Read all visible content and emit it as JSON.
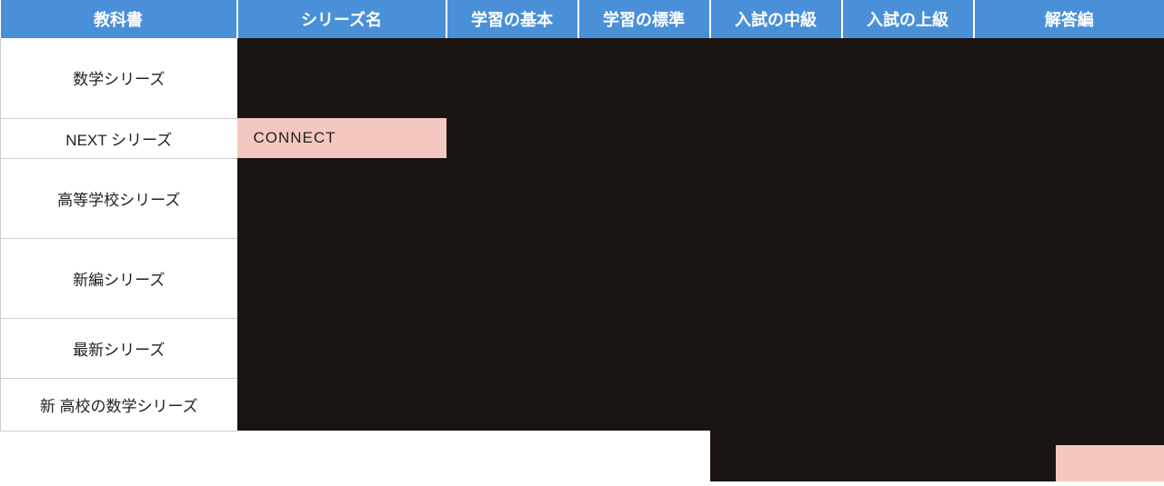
{
  "headers": {
    "textbook": "教科書",
    "series": "シリーズ名",
    "basic": "学習の基本",
    "standard": "学習の標準",
    "mid": "入試の中級",
    "high": "入試の上級",
    "answer": "解答編"
  },
  "rows": {
    "r0": {
      "category": "数学シリーズ"
    },
    "r1": {
      "category": "NEXT シリーズ",
      "series": "CONNECT"
    },
    "r2": {
      "category": "高等学校シリーズ"
    },
    "r3": {
      "category": "新編シリーズ"
    },
    "r4": {
      "category": "最新シリーズ"
    },
    "r5": {
      "category": "新 高校の数学シリーズ"
    }
  }
}
